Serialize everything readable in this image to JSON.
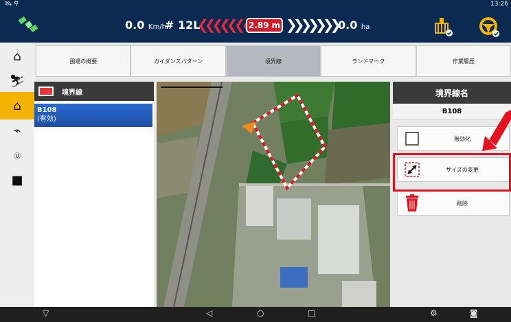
{
  "status": {
    "left_icons": "🛰 ⚲",
    "time": "13:26"
  },
  "topbar": {
    "speed_value": "0.0",
    "speed_unit": "Km/h",
    "lane": "# 12L",
    "offset": "2.89 m",
    "area_value": "0.0",
    "area_unit": "ha"
  },
  "sidebar": {
    "items": [
      {
        "icon": "home-icon",
        "glyph": "⌂"
      },
      {
        "icon": "guidance-icon",
        "glyph": "✈"
      },
      {
        "icon": "field-icon",
        "glyph": "⛶"
      },
      {
        "icon": "signal-icon",
        "glyph": "⚡"
      },
      {
        "icon": "ut-icon",
        "glyph": "UT"
      },
      {
        "icon": "camera-icon",
        "glyph": "■"
      }
    ]
  },
  "tabs": [
    {
      "label": "圃場の概要"
    },
    {
      "label": "ガイダンスパターン"
    },
    {
      "label": "境界線"
    },
    {
      "label": "ランドマーク"
    },
    {
      "label": "作業履歴"
    }
  ],
  "list": {
    "header": "境界線",
    "items": [
      {
        "name": "B108",
        "status": "(有効)"
      }
    ]
  },
  "right_panel": {
    "header": "境界線名",
    "name": "B108",
    "actions": [
      {
        "label": "無効化"
      },
      {
        "label": "サイズの変更"
      },
      {
        "label": "削除"
      }
    ]
  },
  "colors": {
    "accent": "#f3b300",
    "topbar": "#0b2a52",
    "alert": "#e4111e",
    "boundary": "#ffffff"
  }
}
